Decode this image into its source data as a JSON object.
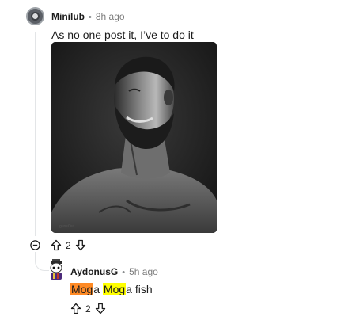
{
  "comment": {
    "author": "Minilub",
    "separator": "•",
    "time": "8h ago",
    "text": "As no one post it, I’ve to do it",
    "vote_count": "2",
    "image_watermark": "gunsOut"
  },
  "reply": {
    "author": "AydonusG",
    "separator": "•",
    "time": "5h ago",
    "parts": [
      "Mog",
      "a ",
      "Mog",
      "a fish"
    ],
    "vote_count": "2"
  },
  "icons": {
    "collapse": "collapse-minus-icon",
    "upvote": "upvote-arrow-icon",
    "downvote": "downvote-arrow-icon"
  },
  "colors": {
    "highlight_orange": "#ff8a25",
    "highlight_yellow": "#ffff00"
  }
}
